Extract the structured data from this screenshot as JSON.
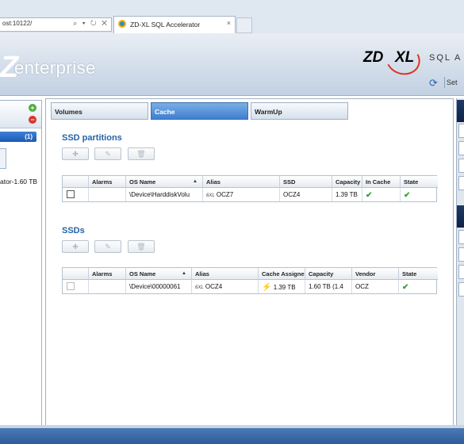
{
  "browser": {
    "address_text": "ost:10122/",
    "address_icons": "⌕ ▾ ↻ ✕",
    "tab_title": "ZD-XL SQL Accelerator",
    "tab_close": "×"
  },
  "header": {
    "logo_mark": "Z",
    "logo_text": "enterprise",
    "brand_zd": "ZD",
    "brand_xl": "XL",
    "product": "SQL A",
    "settings_label": "Set"
  },
  "left_panel": {
    "add_symbol": "+",
    "remove_symbol": "−",
    "group_count": "(1)",
    "device_label": "ator-1.60 TB"
  },
  "tabs": [
    {
      "label": "Volumes"
    },
    {
      "label": "Cache"
    },
    {
      "label": "WarmUp"
    }
  ],
  "ssd_partitions": {
    "title": "SSD partitions",
    "columns": [
      "",
      "Alarms",
      "OS Name",
      "Alias",
      "SSD",
      "Capacity",
      "In Cache",
      "State"
    ],
    "rows": [
      {
        "alarms": "",
        "os_name": "\\Device\\HarddiskVolu",
        "alias_icon": "6XL",
        "alias": "OCZ7",
        "ssd": "OCZ4",
        "capacity": "1.39 TB",
        "in_cache": "✔",
        "state": "✔"
      }
    ]
  },
  "ssds": {
    "title": "SSDs",
    "columns": [
      "",
      "Alarms",
      "OS Name",
      "Alias",
      "Cache Assigne",
      "Capacity",
      "Vendor",
      "State"
    ],
    "rows": [
      {
        "alarms": "",
        "os_name": "\\Device\\00000061",
        "alias_icon": "6XL",
        "alias": "OCZ4",
        "cache_assigned": "1.39 TB",
        "capacity": "1.60 TB (1.4",
        "vendor": "OCZ",
        "state": "✔"
      }
    ]
  },
  "icons": {
    "toolbar": [
      "add-icon",
      "edit-icon",
      "delete-icon"
    ],
    "state_ok": "check-icon",
    "cache_assigned": "bolt-icon"
  },
  "colors": {
    "accent": "#2463a6",
    "active_tab": "#3f7fcf",
    "ok_green": "#3ba13b",
    "bottom_bar": "#2d5c99"
  }
}
